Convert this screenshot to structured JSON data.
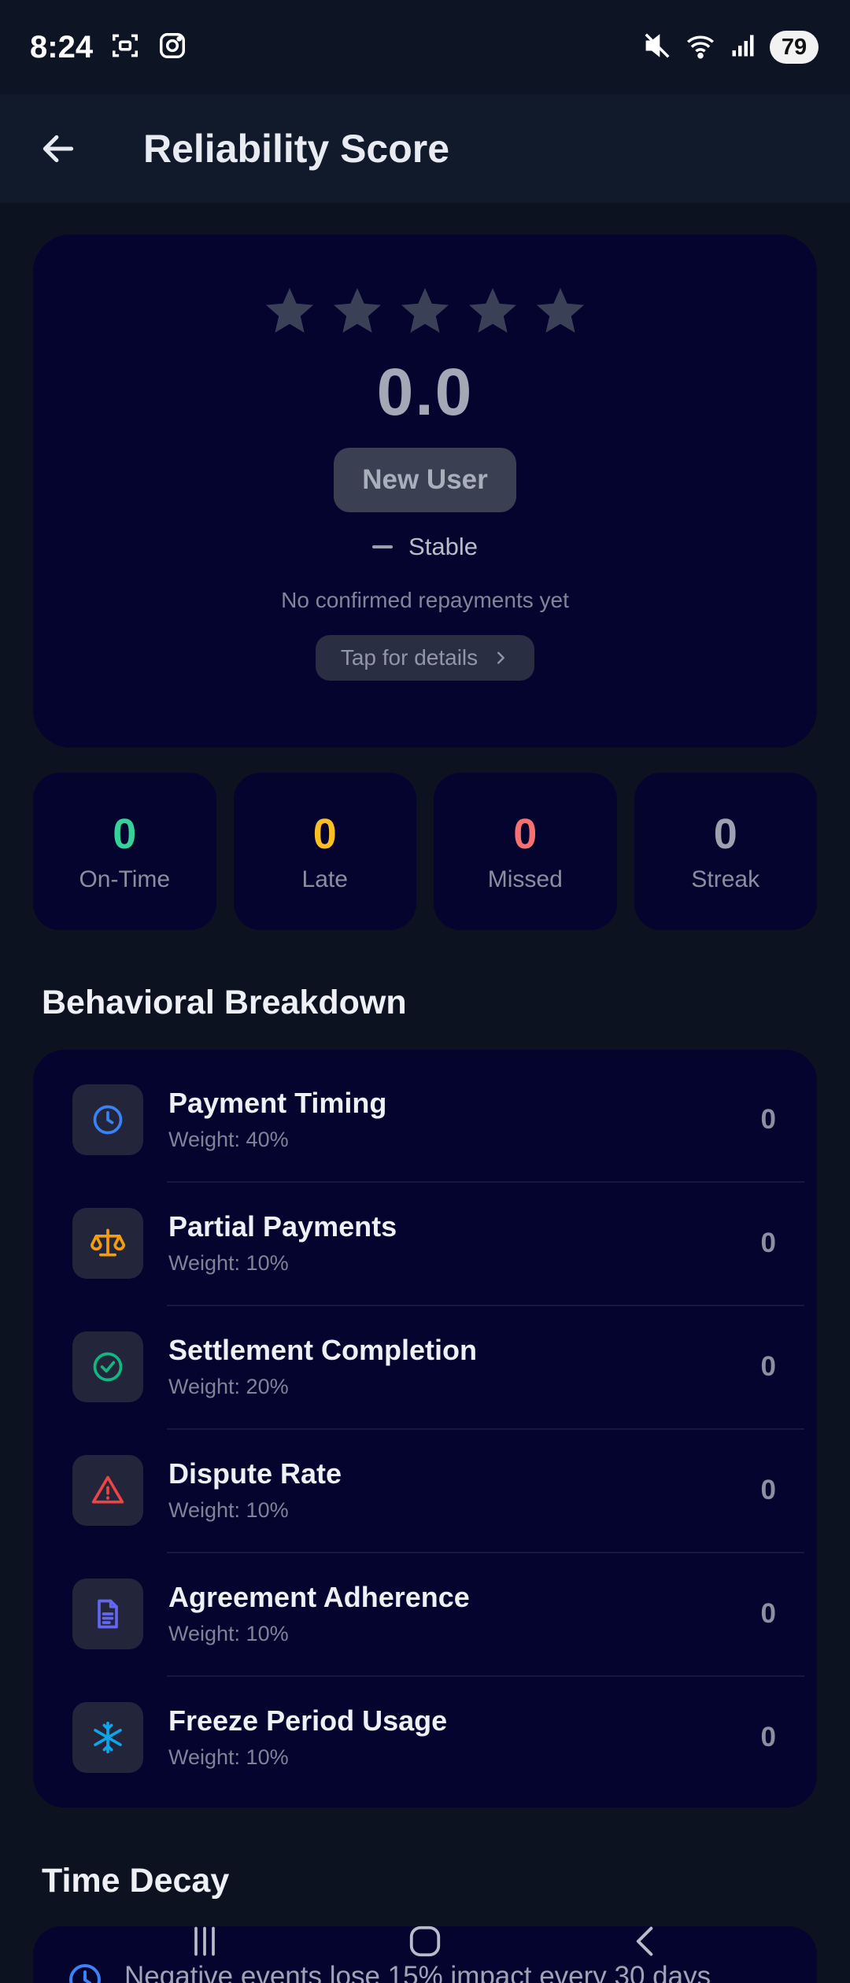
{
  "status_bar": {
    "time": "8:24",
    "battery": "79",
    "icons": [
      "screenshot-icon",
      "instagram-icon",
      "mute-icon",
      "wifi-icon",
      "signal-icon"
    ]
  },
  "app_bar": {
    "title": "Reliability Score",
    "back_icon": "arrow-left-icon"
  },
  "hero": {
    "star_rating": 0,
    "star_count": 5,
    "score": "0.0",
    "tier": "New User",
    "trend": "Stable",
    "subtitle": "No confirmed repayments yet",
    "details_label": "Tap for details"
  },
  "stats": [
    {
      "value": "0",
      "label": "On-Time",
      "color": "#34d399"
    },
    {
      "value": "0",
      "label": "Late",
      "color": "#fbbf24"
    },
    {
      "value": "0",
      "label": "Missed",
      "color": "#f87171"
    },
    {
      "value": "0",
      "label": "Streak",
      "color": "#9ca3af"
    }
  ],
  "breakdown": {
    "title": "Behavioral Breakdown",
    "items": [
      {
        "title": "Payment Timing",
        "weight": "Weight: 40%",
        "score": "0",
        "icon": "clock-icon",
        "color": "#3b82f6"
      },
      {
        "title": "Partial Payments",
        "weight": "Weight: 10%",
        "score": "0",
        "icon": "scale-icon",
        "color": "#f59e0b"
      },
      {
        "title": "Settlement Completion",
        "weight": "Weight: 20%",
        "score": "0",
        "icon": "check-circle-icon",
        "color": "#10b981"
      },
      {
        "title": "Dispute Rate",
        "weight": "Weight: 10%",
        "score": "0",
        "icon": "warning-icon",
        "color": "#ef4444"
      },
      {
        "title": "Agreement Adherence",
        "weight": "Weight: 10%",
        "score": "0",
        "icon": "document-icon",
        "color": "#6366f1"
      },
      {
        "title": "Freeze Period Usage",
        "weight": "Weight: 10%",
        "score": "0",
        "icon": "snowflake-icon",
        "color": "#0ea5e9"
      }
    ]
  },
  "time_decay": {
    "title": "Time Decay",
    "text": "Negative events lose 15% impact every 30 days"
  },
  "colors": {
    "background": "#0c1220",
    "card": "#04042e",
    "star_inactive": "#3a4156"
  }
}
